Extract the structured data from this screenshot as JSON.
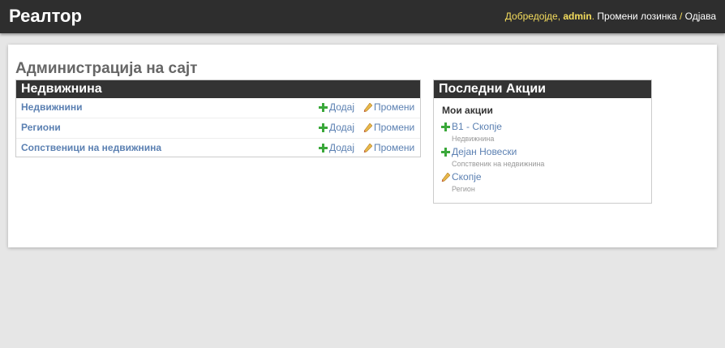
{
  "header": {
    "brand": "Реалтор",
    "welcome": "Добредојде, ",
    "username": "admin",
    "change_password": "Промени лозинка",
    "separator": " / ",
    "logout": "Одјава"
  },
  "main": {
    "title": "Администрација на сајт",
    "app": {
      "caption": "Недвижнина",
      "add_label": "Додај",
      "change_label": "Промени",
      "models": [
        {
          "name": "Недвижнини"
        },
        {
          "name": "Региони"
        },
        {
          "name": "Сопственици на недвижнина"
        }
      ]
    }
  },
  "recent": {
    "caption": "Последни Акции",
    "subtitle": "Мои акции",
    "entries": [
      {
        "label": "B1 - Скопје",
        "type": "Недвижнина",
        "action": "add",
        "icon": "plus-icon"
      },
      {
        "label": "Дејан Новески",
        "type": "Сопственик на недвижнина",
        "action": "add",
        "icon": "plus-icon"
      },
      {
        "label": "Скопје",
        "type": "Регион",
        "action": "change",
        "icon": "pencil-icon"
      }
    ]
  },
  "colors": {
    "header_bg": "#2e2e2e",
    "link": "#5b80b2",
    "user_yellow": "#f5dd5d",
    "caption_bg": "#333333",
    "add_green": "#3aa83a"
  }
}
